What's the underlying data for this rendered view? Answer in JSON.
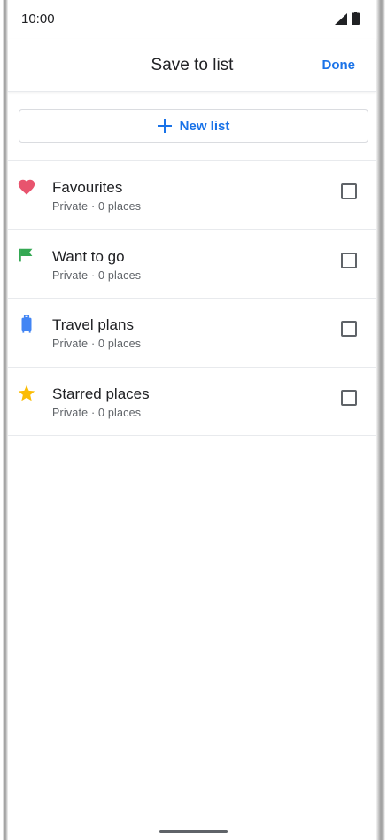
{
  "status_bar": {
    "time": "10:00"
  },
  "header": {
    "title": "Save to list",
    "done_label": "Done"
  },
  "new_list": {
    "label": "New list"
  },
  "lists": [
    {
      "title": "Favourites",
      "subtitle": "Private · 0 places",
      "icon": "heart-icon",
      "color": "#e8546e",
      "checked": false
    },
    {
      "title": "Want to go",
      "subtitle": "Private · 0 places",
      "icon": "flag-icon",
      "color": "#34a853",
      "checked": false
    },
    {
      "title": "Travel plans",
      "subtitle": "Private · 0 places",
      "icon": "suitcase-icon",
      "color": "#4285f4",
      "checked": false
    },
    {
      "title": "Starred places",
      "subtitle": "Private · 0 places",
      "icon": "star-icon",
      "color": "#fbbc04",
      "checked": false
    }
  ],
  "colors": {
    "accent": "#1a73e8",
    "text_primary": "#202124",
    "text_secondary": "#5f6368",
    "divider": "#e8eaed"
  }
}
